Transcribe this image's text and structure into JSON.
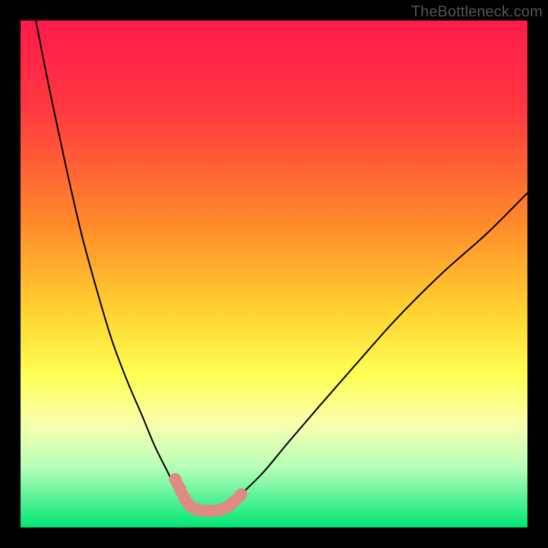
{
  "watermark": "TheBottleneck.com",
  "chart_data": {
    "type": "line",
    "title": "",
    "xlabel": "",
    "ylabel": "",
    "xlim": [
      0,
      100
    ],
    "ylim": [
      0,
      100
    ],
    "gradient_stops": [
      {
        "offset": 0,
        "color": "#ff1a4b"
      },
      {
        "offset": 18,
        "color": "#ff3a3f"
      },
      {
        "offset": 40,
        "color": "#ff8a2a"
      },
      {
        "offset": 58,
        "color": "#ffd531"
      },
      {
        "offset": 70,
        "color": "#ffff55"
      },
      {
        "offset": 80,
        "color": "#f6ffb0"
      },
      {
        "offset": 88,
        "color": "#b8ffb8"
      },
      {
        "offset": 100,
        "color": "#00e676"
      }
    ],
    "series": [
      {
        "name": "left-curve",
        "x": [
          3,
          6,
          9,
          12,
          15,
          18,
          21,
          24,
          26.5,
          29,
          31,
          33
        ],
        "y": [
          100,
          85,
          71,
          58,
          47,
          37,
          29,
          22,
          16,
          11,
          7,
          4
        ]
      },
      {
        "name": "right-curve",
        "x": [
          41,
          44,
          48,
          53,
          59,
          66,
          74,
          83,
          92,
          100
        ],
        "y": [
          4,
          7,
          11,
          17,
          24,
          32,
          41,
          50,
          58,
          66
        ]
      },
      {
        "name": "markers",
        "x": [
          30.5,
          31.5,
          32.5,
          33.5,
          35,
          36.5,
          38,
          39.5,
          41,
          42,
          43.5
        ],
        "y": [
          9.5,
          7.5,
          5.5,
          4.2,
          3.5,
          3.3,
          3.3,
          3.5,
          4.2,
          5.0,
          6.5
        ]
      }
    ],
    "marker_color": "#e08a84",
    "marker_radius": 9
  }
}
